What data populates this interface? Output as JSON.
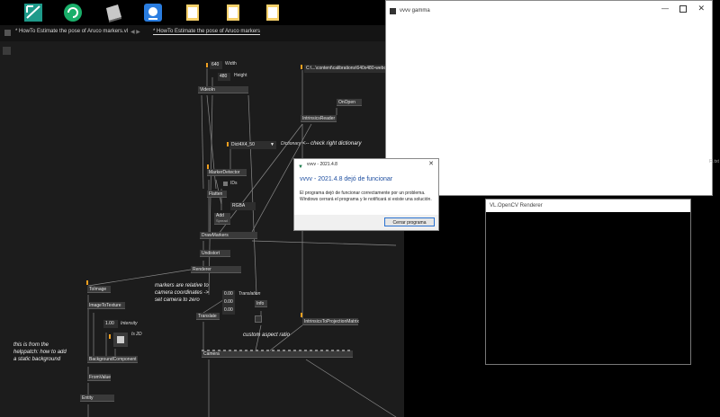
{
  "editor": {
    "tabs": {
      "tab1": "* HowTo Estimate the pose of Aruco markers.vl",
      "tab2": "* HowTo Estimate the pose of Aruco markers"
    },
    "nodes": {
      "width_val": "640",
      "width_lbl": "Width",
      "height_val": "480",
      "height_lbl": "Height",
      "videoin": "VideoIn",
      "path": "C:\\...\\content\\calibrations\\640x480-webca",
      "onopen": "OnOpen",
      "intrinsics_reader": "IntrinsicsReader",
      "dictionary_val": "Dict4X4_50",
      "dictionary_lbl": "Dictionary",
      "marker_detector": "MarkerDetector",
      "ids": "IDs",
      "flatten": "Flatten",
      "rgba": "RGBA",
      "add": "Add",
      "add_sub": "Spread",
      "drawmarkers": "DrawMarkers",
      "undistort": "Undistort",
      "renderer": "Renderer",
      "toimage": "ToImage",
      "image_to_texture": "ImageToTexture",
      "intensity_val": "1.00",
      "intensity_lbl": "Intensity",
      "is2d_lbl": "Is 2D",
      "background_component": "BackgroundComponent",
      "fromvalue": "FromValue",
      "entity": "Entity",
      "translation_x": "0.00",
      "translation_y": "0.00",
      "translation_z": "0.00",
      "translation_lbl": "Translation",
      "translate": "Translate",
      "info": "Info",
      "intrinsics_to_projection": "IntrinsicsToProjectionMatrix",
      "camera": "Camera"
    },
    "comments": {
      "check_dictionary": "<-- check right dictionary",
      "markers_relative": "markers are relative to\ncamera coordinates ->\nset camera to zero",
      "helppatch": "this is from the\nhelppatch: how to add\na static background",
      "aspect_ratio": "custom aspect ratio"
    }
  },
  "gamma_window": {
    "title": "vvvv gamma"
  },
  "renderer_window": {
    "title": "VL.OpenCV Renderer"
  },
  "behind_text": "Fl.txt",
  "dialog": {
    "title": "vvvv - 2021.4.8",
    "heading": "vvvv - 2021.4.8 dejó de funcionar",
    "body": "El programa dejó de funcionar correctamente por un problema. Windows cerrará el programa y le notificará si existe una solución.",
    "button": "Cerrar programa"
  },
  "colors": {
    "accent": "#f0a020",
    "dialog_heading": "#1f4fa0",
    "patch_bg": "#1c1c1c"
  }
}
